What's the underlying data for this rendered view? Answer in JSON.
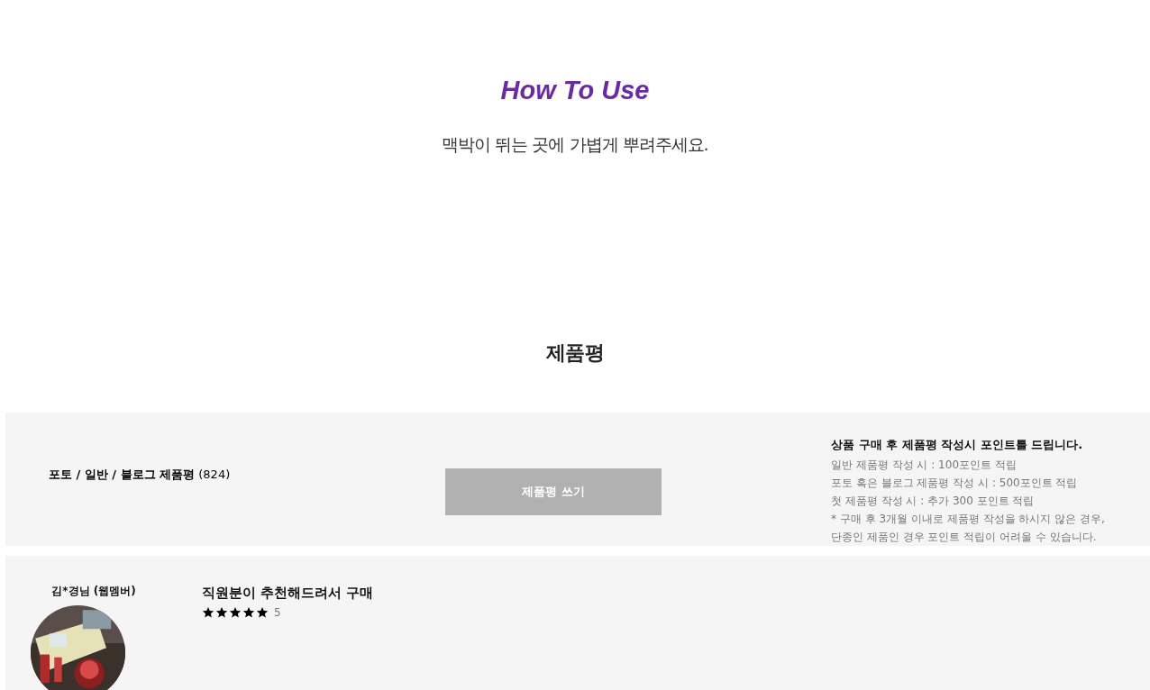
{
  "how_to_use": {
    "title": "How To Use",
    "instruction": "맥박이 뛰는 곳에 가볍게 뿌려주세요."
  },
  "reviews_section": {
    "title": "제품평",
    "summary": {
      "label": "**포토 / 일반 / 블로그 제품평** (824)",
      "write_button": "제품평 쓰기",
      "points_title": "상품 구매 후 제품평 작성시 포인트틀 드립니다.",
      "points_lines": [
        "일반 제품평 작성 시 : 100포인트 적립",
        "포토 혹은 블로그 제품평 작성 시 : 500포인트 적립",
        "첫 제품평 작성 시 : 추가 300 포인트 적립",
        "* 구매 후 3개월 이내로 제품평 작성을 하시지 않은 경우,",
        "단종인 제품인 경우 포인트 적립이 어려울 수 있습니다."
      ]
    },
    "reviews": [
      {
        "author": "김*경님 (웹멤버)",
        "title": "직원분이 추천해드려서 구매",
        "stars": 5,
        "rating": "5"
      }
    ]
  }
}
